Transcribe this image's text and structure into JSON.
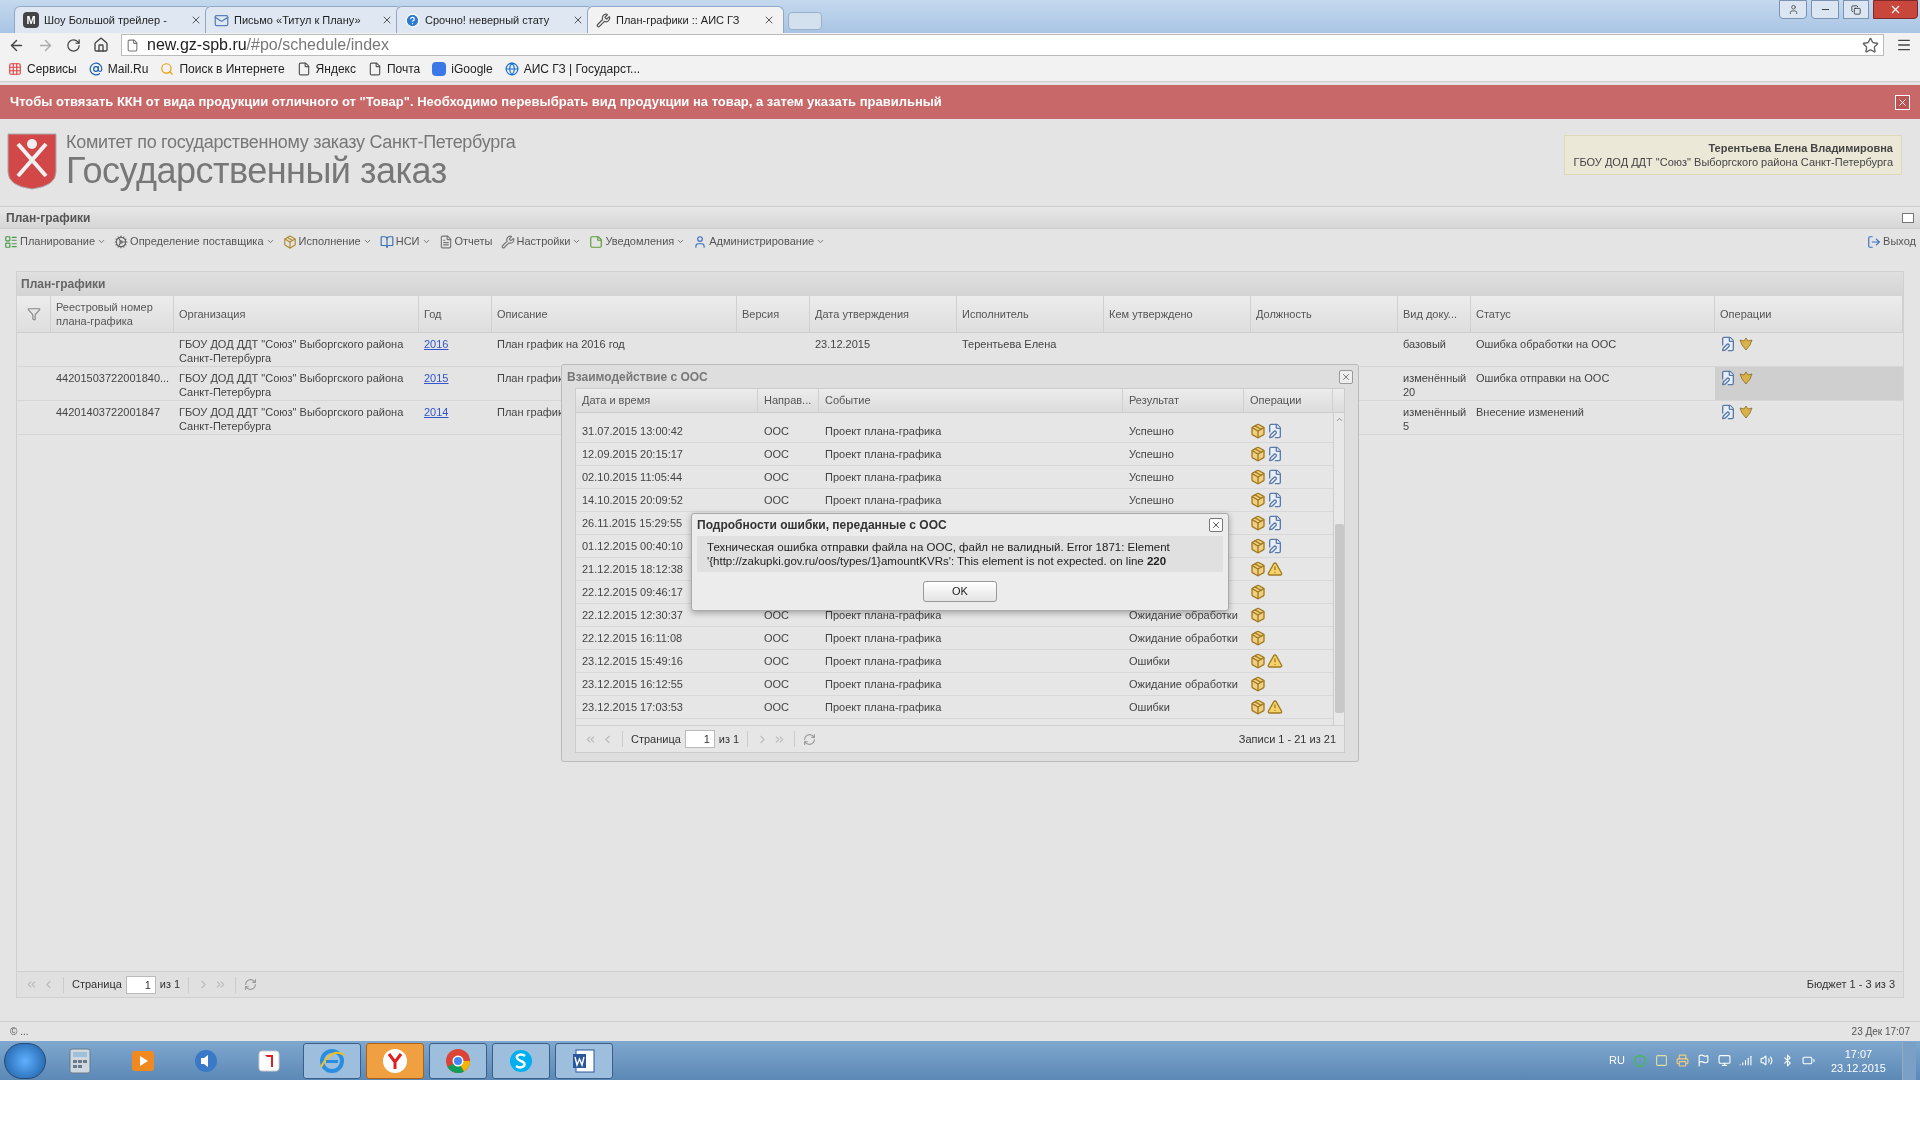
{
  "browser": {
    "tabs": [
      {
        "title": "Шоу Большой трейлер -",
        "kind": "letter",
        "selected": false
      },
      {
        "title": "Письмо «Титул к Плану»",
        "kind": "mail",
        "selected": false
      },
      {
        "title": "Срочно! неверный стату",
        "kind": "help",
        "selected": false
      },
      {
        "title": "План-графики :: АИС ГЗ",
        "kind": "tool",
        "selected": true
      }
    ],
    "tab_letter": "M",
    "address": {
      "host": "new.gz-spb.ru",
      "path": "/#po/schedule/index"
    },
    "bookmarks": [
      {
        "label": "Сервисы",
        "kind": "apps"
      },
      {
        "label": "Mail.Ru",
        "kind": "at"
      },
      {
        "label": "Поиск в Интернете",
        "kind": "search"
      },
      {
        "label": "Яндекс",
        "kind": "page"
      },
      {
        "label": "Почта",
        "kind": "page"
      },
      {
        "label": "iGoogle",
        "kind": "g"
      },
      {
        "label": "АИС ГЗ | Государст...",
        "kind": "globe"
      }
    ]
  },
  "banner": {
    "text": "Чтобы отвязать ККН от вида продукции отличного от \"Товар\". Необходимо перевыбрать вид продукции на товар, а затем указать правильный"
  },
  "header": {
    "org": "Комитет по государственному заказу Санкт-Петербурга",
    "title": "Государственный заказ",
    "user_name": "Терентьева Елена Владимировна",
    "user_org": "ГБОУ ДОД ДДТ \"Союз\" Выборгского района Санкт-Петербурга"
  },
  "section_title": "План-графики",
  "menu": [
    {
      "label": "Планирование",
      "kind": "plan",
      "dropdown": true
    },
    {
      "label": "Определение поставщика",
      "kind": "gears",
      "dropdown": true
    },
    {
      "label": "Исполнение",
      "kind": "box",
      "dropdown": true
    },
    {
      "label": "НСИ",
      "kind": "book",
      "dropdown": true
    },
    {
      "label": "Отчеты",
      "kind": "report",
      "dropdown": false
    },
    {
      "label": "Настройки",
      "kind": "wrench",
      "dropdown": true
    },
    {
      "label": "Уведомления",
      "kind": "note",
      "dropdown": true
    },
    {
      "label": "Администрирование",
      "kind": "user",
      "dropdown": true
    }
  ],
  "logout": "Выход",
  "panel": {
    "title": "План-графики",
    "columns": [
      "Реестровый номер плана-графика",
      "Организация",
      "Год",
      "Описание",
      "Версия",
      "Дата утверждения",
      "Исполнитель",
      "Кем утверждено",
      "Должность",
      "Вид доку...",
      "Статус",
      "Операции"
    ],
    "rows": [
      {
        "number": "",
        "org": "ГБОУ ДОД ДДТ \"Союз\" Выборгского района Санкт-Петербурга",
        "year": "2016",
        "description": "План график на 2016 год",
        "date": "23.12.2015",
        "executor": "Терентьева Елена",
        "doc_kind": "базовый",
        "status": "Ошибка обработки на ООС",
        "selected": false
      },
      {
        "number": "44201503722001840...",
        "org": "ГБОУ ДОД ДДТ \"Союз\" Выборгского района Санкт-Петербурга",
        "year": "2015",
        "description": "План график",
        "date": "",
        "executor": "",
        "doc_kind": "изменённый 20",
        "status": "Ошибка отправки на ООС",
        "selected": true
      },
      {
        "number": "44201403722001847",
        "org": "ГБОУ ДОД ДДТ \"Союз\" Выборгского района Санкт-Петербурга",
        "year": "2014",
        "description": "План график",
        "date": "",
        "executor": "",
        "doc_kind": "изменённый 5",
        "status": "Внесение изменений",
        "selected": false
      }
    ],
    "pager": {
      "page_label": "Страница",
      "page": "1",
      "of": "из 1",
      "summary": "Бюджет 1 - 3 из 3"
    }
  },
  "status_bar": {
    "left": "© ...",
    "right": "23 Дек 17:07"
  },
  "dialog": {
    "title": "Взаимодействие с ООС",
    "columns": [
      "Дата и время",
      "Направ...",
      "Событие",
      "Результат",
      "Операции"
    ],
    "rows": [
      {
        "date": "31.07.2015 13:00:42",
        "direction": "ООС",
        "event": "Проект плана-графика",
        "result": "Успешно",
        "kind": "sent"
      },
      {
        "date": "12.09.2015 20:15:17",
        "direction": "ООС",
        "event": "Проект плана-графика",
        "result": "Успешно",
        "kind": "sent"
      },
      {
        "date": "02.10.2015 11:05:44",
        "direction": "ООС",
        "event": "Проект плана-графика",
        "result": "Успешно",
        "kind": "sent"
      },
      {
        "date": "14.10.2015 20:09:52",
        "direction": "ООС",
        "event": "Проект плана-графика",
        "result": "Успешно",
        "kind": "sent"
      },
      {
        "date": "26.11.2015 15:29:55",
        "kind": "sent"
      },
      {
        "date": "01.12.2015 00:40:10",
        "kind": "sent"
      },
      {
        "date": "21.12.2015 18:12:38",
        "kind": "error"
      },
      {
        "date": "22.12.2015 09:46:17",
        "kind": "pending"
      },
      {
        "date": "22.12.2015 12:30:37",
        "direction": "ООС",
        "event": "Проект плана-графика",
        "result": "Ожидание обработки",
        "kind": "pending"
      },
      {
        "date": "22.12.2015 16:11:08",
        "direction": "ООС",
        "event": "Проект плана-графика",
        "result": "Ожидание обработки",
        "kind": "pending"
      },
      {
        "date": "23.12.2015 15:49:16",
        "direction": "ООС",
        "event": "Проект плана-графика",
        "result": "Ошибки",
        "kind": "error"
      },
      {
        "date": "23.12.2015 16:12:55",
        "direction": "ООС",
        "event": "Проект плана-графика",
        "result": "Ожидание обработки",
        "kind": "pending"
      },
      {
        "date": "23.12.2015 17:03:53",
        "direction": "ООС",
        "event": "Проект плана-графика",
        "result": "Ошибки",
        "kind": "error"
      }
    ],
    "pager": {
      "page_label": "Страница",
      "page": "1",
      "of": "из 1",
      "summary": "Записи 1 - 21 из 21"
    }
  },
  "error_dialog": {
    "title": "Подробности ошибки, переданные с ООС",
    "message": "Техническая ошибка отправки файла на ООС, файл не валидный. Error 1871: Element '{http://zakupki.gov.ru/oos/types/1}amountKVRs': This element is not expected. on line **220**",
    "button": "OK"
  },
  "taskbar": {
    "apps": [
      {
        "kind": "calc",
        "running": false
      },
      {
        "kind": "media",
        "running": false
      },
      {
        "kind": "sound",
        "running": false
      },
      {
        "kind": "redapp",
        "running": false
      },
      {
        "kind": "ie",
        "running": true
      },
      {
        "kind": "ybrowser",
        "running": true
      },
      {
        "kind": "chrome",
        "running": true
      },
      {
        "kind": "skype",
        "running": true
      },
      {
        "kind": "word",
        "running": true
      }
    ],
    "lang": "RU",
    "time": "17:07",
    "date": "23.12.2015"
  }
}
